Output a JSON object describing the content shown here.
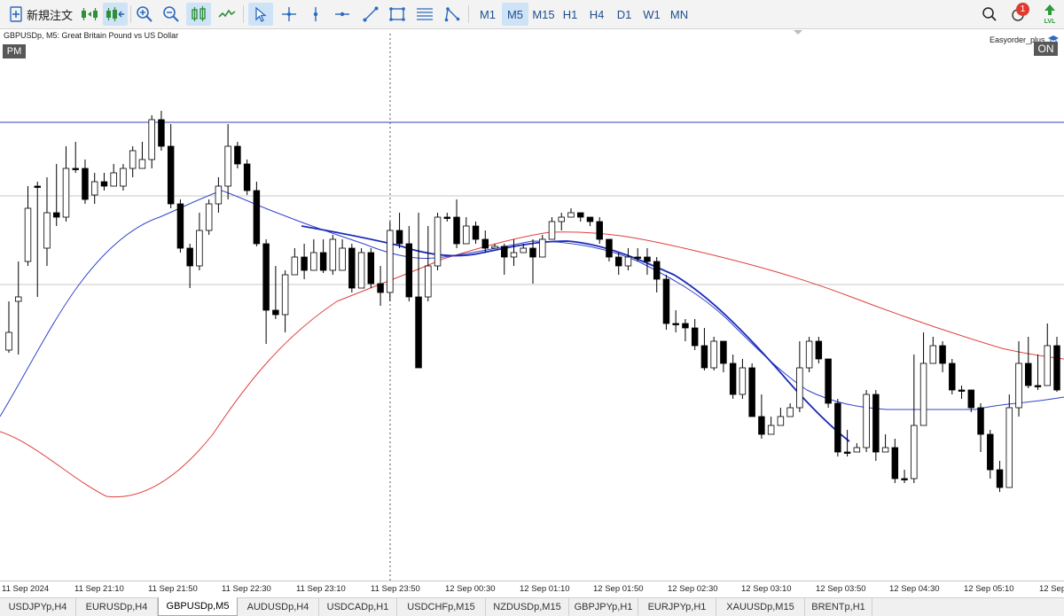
{
  "toolbar": {
    "new_order_label": "新規注文",
    "timeframes": [
      "M1",
      "M5",
      "M15",
      "H1",
      "H4",
      "D1",
      "W1",
      "MN"
    ],
    "active_timeframe": "M5",
    "notification_count": "1"
  },
  "chart": {
    "symbol_title": "GBPUSDp, M5:  Great Britain Pound vs US Dollar",
    "session_badge": "PM",
    "ea_name": "Easyorder_plus",
    "ea_state": "ON",
    "time_labels": [
      "11 Sep 2024",
      "11 Sep 21:10",
      "11 Sep 21:50",
      "11 Sep 22:30",
      "11 Sep 23:10",
      "11 Sep 23:50",
      "12 Sep 00:30",
      "12 Sep 01:10",
      "12 Sep 01:50",
      "12 Sep 02:30",
      "12 Sep 03:10",
      "12 Sep 03:50",
      "12 Sep 04:30",
      "12 Sep 05:10",
      "12 Sep"
    ]
  },
  "tabs": [
    {
      "label": "USDJPYp,H4"
    },
    {
      "label": "EURUSDp,H4"
    },
    {
      "label": "GBPUSDp,M5",
      "active": true
    },
    {
      "label": "AUDUSDp,H4"
    },
    {
      "label": "USDCADp,H1"
    },
    {
      "label": "USDCHFp,M15"
    },
    {
      "label": "NZDUSDp,M15"
    },
    {
      "label": "GBPJPYp,H1"
    },
    {
      "label": "EURJPYp,H1"
    },
    {
      "label": "XAUUSDp,M15"
    },
    {
      "label": "BRENTp,H1"
    }
  ],
  "colors": {
    "bull_candle": "#ffffff",
    "bear_candle": "#000000",
    "ma_fast": "#3344cc",
    "ma_slow": "#e04040",
    "ma_trend": "#1a2bb8",
    "level_line": "#3040c0"
  },
  "chart_data": {
    "type": "candlestick",
    "title": "GBPUSDp, M5:  Great Britain Pound vs US Dollar",
    "x": [
      "11 Sep 2024",
      "11 Sep 21:10",
      "11 Sep 21:50",
      "11 Sep 22:30",
      "11 Sep 23:10",
      "11 Sep 23:50",
      "12 Sep 00:30",
      "12 Sep 01:10",
      "12 Sep 01:50",
      "12 Sep 02:30",
      "12 Sep 03:10",
      "12 Sep 03:50",
      "12 Sep 04:30",
      "12 Sep 05:10",
      "12 Sep"
    ],
    "candles_ohlc_relative": [
      [
        395,
        375,
        398,
        340
      ],
      [
        340,
        335,
        400,
        295
      ],
      [
        295,
        235,
        300,
        210
      ],
      [
        210,
        210,
        335,
        205
      ],
      [
        280,
        240,
        300,
        200
      ],
      [
        240,
        245,
        255,
        185
      ],
      [
        245,
        190,
        250,
        165
      ],
      [
        190,
        190,
        195,
        160
      ],
      [
        190,
        225,
        230,
        180
      ],
      [
        220,
        205,
        230,
        195
      ],
      [
        205,
        210,
        215,
        195
      ],
      [
        210,
        195,
        205,
        185
      ],
      [
        210,
        190,
        215,
        185
      ],
      [
        190,
        170,
        200,
        165
      ],
      [
        190,
        180,
        185,
        160
      ],
      [
        180,
        135,
        190,
        130
      ],
      [
        135,
        165,
        170,
        125
      ],
      [
        165,
        230,
        235,
        140
      ],
      [
        230,
        280,
        285,
        225
      ],
      [
        280,
        300,
        325,
        275
      ],
      [
        300,
        260,
        305,
        240
      ],
      [
        260,
        230,
        265,
        225
      ],
      [
        230,
        210,
        240,
        200
      ],
      [
        210,
        165,
        225,
        140
      ],
      [
        165,
        185,
        190,
        160
      ],
      [
        185,
        215,
        220,
        180
      ],
      [
        215,
        275,
        278,
        205
      ],
      [
        275,
        350,
        388,
        270
      ],
      [
        350,
        355,
        360,
        300
      ],
      [
        355,
        310,
        375,
        305
      ],
      [
        310,
        290,
        305,
        280
      ],
      [
        290,
        305,
        315,
        275
      ],
      [
        305,
        285,
        290,
        270
      ],
      [
        285,
        305,
        308,
        270
      ],
      [
        305,
        270,
        310,
        265
      ],
      [
        305,
        280,
        295,
        270
      ],
      [
        280,
        325,
        330,
        275
      ],
      [
        325,
        285,
        325,
        280
      ],
      [
        285,
        320,
        325,
        280
      ],
      [
        320,
        330,
        345,
        300
      ],
      [
        330,
        260,
        340,
        250
      ],
      [
        260,
        275,
        280,
        240
      ],
      [
        275,
        335,
        340,
        255
      ],
      [
        335,
        415,
        415,
        240
      ],
      [
        335,
        300,
        340,
        255
      ],
      [
        300,
        245,
        305,
        240
      ],
      [
        245,
        245,
        250,
        240
      ],
      [
        245,
        275,
        280,
        225
      ],
      [
        275,
        255,
        275,
        245
      ],
      [
        255,
        270,
        275,
        250
      ],
      [
        270,
        280,
        285,
        260
      ],
      [
        280,
        278,
        280,
        275
      ],
      [
        278,
        290,
        310,
        275
      ],
      [
        290,
        285,
        300,
        270
      ],
      [
        285,
        280,
        285,
        275
      ],
      [
        280,
        290,
        320,
        270
      ],
      [
        290,
        270,
        290,
        265
      ],
      [
        270,
        250,
        255,
        245
      ],
      [
        250,
        245,
        260,
        240
      ],
      [
        245,
        240,
        245,
        235
      ],
      [
        240,
        245,
        250,
        240
      ],
      [
        245,
        250,
        255,
        245
      ],
      [
        250,
        270,
        275,
        245
      ],
      [
        270,
        290,
        295,
        270
      ],
      [
        290,
        300,
        310,
        285
      ],
      [
        300,
        290,
        305,
        280
      ],
      [
        290,
        290,
        295,
        280
      ],
      [
        290,
        295,
        310,
        280
      ],
      [
        295,
        315,
        330,
        290
      ],
      [
        315,
        365,
        372,
        310
      ],
      [
        365,
        365,
        375,
        350
      ],
      [
        365,
        370,
        385,
        360
      ],
      [
        370,
        390,
        395,
        360
      ],
      [
        390,
        415,
        418,
        370
      ],
      [
        415,
        385,
        418,
        380
      ],
      [
        385,
        410,
        420,
        395
      ],
      [
        410,
        445,
        450,
        400
      ],
      [
        445,
        415,
        450,
        405
      ],
      [
        415,
        470,
        470,
        410
      ],
      [
        470,
        490,
        495,
        445
      ],
      [
        490,
        480,
        490,
        470
      ],
      [
        480,
        470,
        480,
        460
      ],
      [
        470,
        460,
        470,
        455
      ],
      [
        460,
        415,
        465,
        385
      ],
      [
        415,
        385,
        420,
        380
      ],
      [
        385,
        405,
        410,
        380
      ],
      [
        405,
        455,
        460,
        405
      ],
      [
        455,
        510,
        515,
        450
      ],
      [
        510,
        510,
        515,
        485
      ],
      [
        510,
        505,
        510,
        500
      ],
      [
        505,
        445,
        510,
        440
      ],
      [
        445,
        510,
        520,
        440
      ],
      [
        510,
        505,
        510,
        490
      ],
      [
        505,
        540,
        545,
        495
      ],
      [
        540,
        540,
        545,
        530
      ],
      [
        540,
        480,
        545,
        400
      ],
      [
        480,
        410,
        480,
        375
      ],
      [
        410,
        390,
        410,
        380
      ],
      [
        390,
        410,
        420,
        385
      ],
      [
        410,
        440,
        445,
        405
      ],
      [
        440,
        440,
        450,
        435
      ],
      [
        440,
        460,
        465,
        455
      ],
      [
        460,
        490,
        510,
        455
      ],
      [
        490,
        530,
        540,
        485
      ],
      [
        530,
        550,
        555,
        520
      ],
      [
        550,
        460,
        550,
        445
      ],
      [
        460,
        410,
        470,
        385
      ],
      [
        410,
        435,
        438,
        380
      ],
      [
        435,
        435,
        440,
        400
      ],
      [
        435,
        390,
        395,
        365
      ],
      [
        390,
        440,
        442,
        380
      ]
    ],
    "moving_averages": [
      {
        "color": "#3344cc"
      },
      {
        "color": "#e04040"
      },
      {
        "color": "#1a2bb8"
      }
    ]
  }
}
